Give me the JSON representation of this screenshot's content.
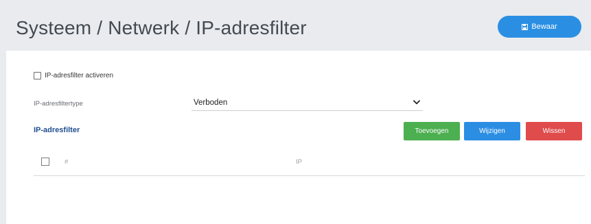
{
  "header": {
    "title": "Systeem / Netwerk / IP-adresfilter",
    "save_label": "Bewaar",
    "save_icon": "floppy-disk-icon"
  },
  "form": {
    "enable_label": "IP-adresfilter activeren",
    "enable_checked": false,
    "type_label": "IP-adresfiltertype",
    "type_value": "Verboden"
  },
  "filter": {
    "section_title": "IP-adresfilter",
    "add_label": "Toevoegen",
    "edit_label": "Wijzigen",
    "delete_label": "Wissen",
    "columns": [
      "#",
      "IP"
    ],
    "rows": []
  },
  "colors": {
    "primary": "#2a8fe3",
    "success": "#4caf50",
    "danger": "#e04b4b",
    "section_title": "#1f4d8f",
    "background": "#e9ebee"
  }
}
